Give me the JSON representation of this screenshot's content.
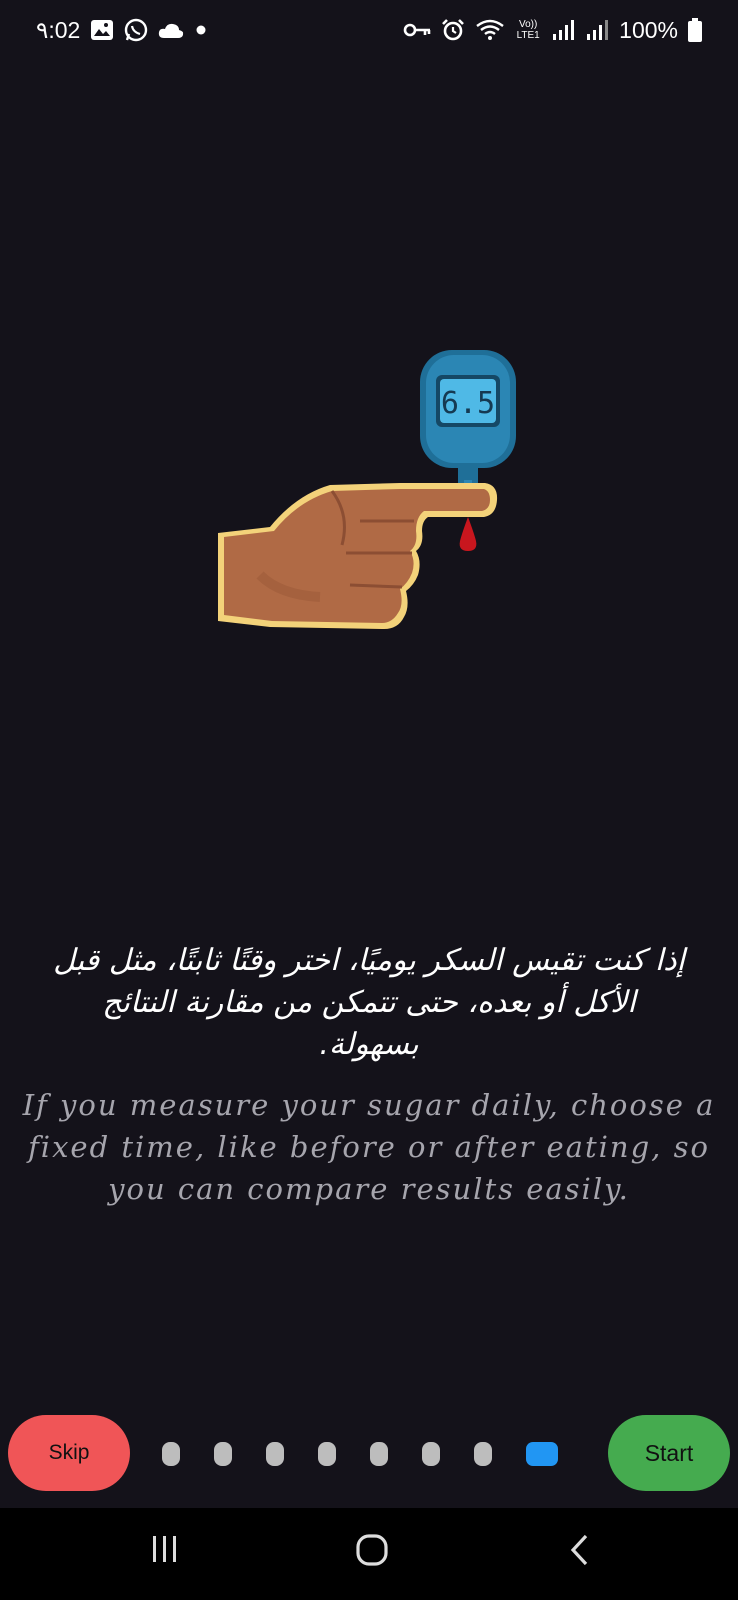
{
  "status_bar": {
    "time": "٩:02",
    "battery": "100%",
    "network_label": "Vo)) LTE1"
  },
  "content": {
    "meter_reading": "6.5",
    "arabic_text": "إذا كنت تقيس السكر يوميًا، اختر وقتًا ثابتًا، مثل قبل الأكل أو بعده، حتى تتمكن من مقارنة النتائج بسهولة.",
    "english_text": "If you measure your sugar daily, choose a fixed time, like before or after eating, so you can compare results easily."
  },
  "onboarding": {
    "skip_label": "Skip",
    "start_label": "Start",
    "page_count": 8,
    "current_page": 8
  },
  "colors": {
    "background": "#14121a",
    "skip": "#f05557",
    "start": "#45ab4f",
    "active_dot": "#2196f3",
    "inactive_dot": "#bdbdbd"
  },
  "icons": {
    "status_left": [
      "gallery-icon",
      "whatsapp-icon",
      "cloud-icon",
      "notification-dot-icon"
    ],
    "status_right": [
      "key-icon",
      "alarm-icon",
      "wifi-icon",
      "signal-icon",
      "signal-icon",
      "battery-icon"
    ],
    "nav": [
      "recent-apps-icon",
      "home-icon",
      "back-icon"
    ]
  }
}
